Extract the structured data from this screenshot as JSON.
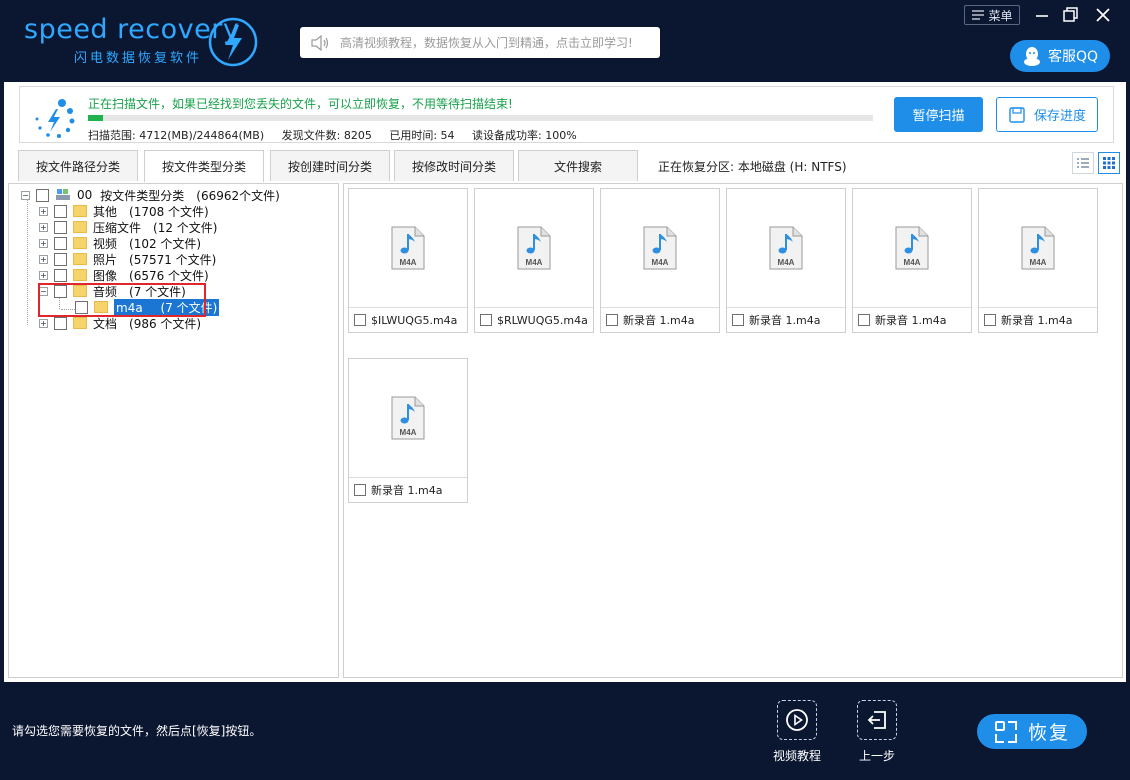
{
  "app": {
    "brand_name": "speed recovery",
    "brand_sub": "闪电数据恢复软件",
    "search_placeholder": "高清视频教程，数据恢复从入门到精通，点击立即学习!",
    "menu_label": "菜单",
    "qq_label": "客服QQ"
  },
  "scan": {
    "message": "正在扫描文件，如果已经找到您丢失的文件，可以立即恢复，不用等待扫描结束!",
    "range": "扫描范围: 4712(MB)/244864(MB)",
    "found": "发现文件数: 8205",
    "time": "已用时间: 54",
    "success": "读设备成功率: 100%",
    "progress_fraction": 0.019,
    "pause_label": "暂停扫描",
    "save_label": "保存进度"
  },
  "tabs": [
    {
      "label": "按文件路径分类"
    },
    {
      "label": "按文件类型分类"
    },
    {
      "label": "按创建时间分类"
    },
    {
      "label": "按修改时间分类"
    },
    {
      "label": "文件搜索"
    }
  ],
  "partition": "正在恢复分区: 本地磁盘 (H: NTFS)",
  "tree": {
    "root": {
      "id": "00",
      "label": "按文件类型分类",
      "count": "(66962个文件)"
    },
    "items": [
      {
        "label": "其他",
        "count": "(1708 个文件)"
      },
      {
        "label": "压缩文件",
        "count": "(12 个文件)"
      },
      {
        "label": "视频",
        "count": "(102 个文件)"
      },
      {
        "label": "照片",
        "count": "(57571 个文件)"
      },
      {
        "label": "图像",
        "count": "(6576 个文件)"
      },
      {
        "label": "音频",
        "count": "(7 个文件)"
      },
      {
        "label": "m4a",
        "count": "(7 个文件)"
      },
      {
        "label": "文档",
        "count": "(986 个文件)"
      }
    ]
  },
  "files": [
    {
      "name": "$ILWUQG5.m4a",
      "type": "M4A"
    },
    {
      "name": "$RLWUQG5.m4a",
      "type": "M4A"
    },
    {
      "name": "新录音 1.m4a",
      "type": "M4A"
    },
    {
      "name": "新录音 1.m4a",
      "type": "M4A"
    },
    {
      "name": "新录音 1.m4a",
      "type": "M4A"
    },
    {
      "name": "新录音 1.m4a",
      "type": "M4A"
    },
    {
      "name": "新录音 1.m4a",
      "type": "M4A"
    }
  ],
  "bottom": {
    "hint": "请勾选您需要恢复的文件，然后点[恢复]按钮。",
    "video_label": "视频教程",
    "back_label": "上一步",
    "recover_label": "恢复"
  },
  "colors": {
    "accent": "#1e8ee9",
    "progress": "#20b24c",
    "scan_text": "#16a24a",
    "highlight": "#1a76d2",
    "annotation": "#e0252b"
  }
}
